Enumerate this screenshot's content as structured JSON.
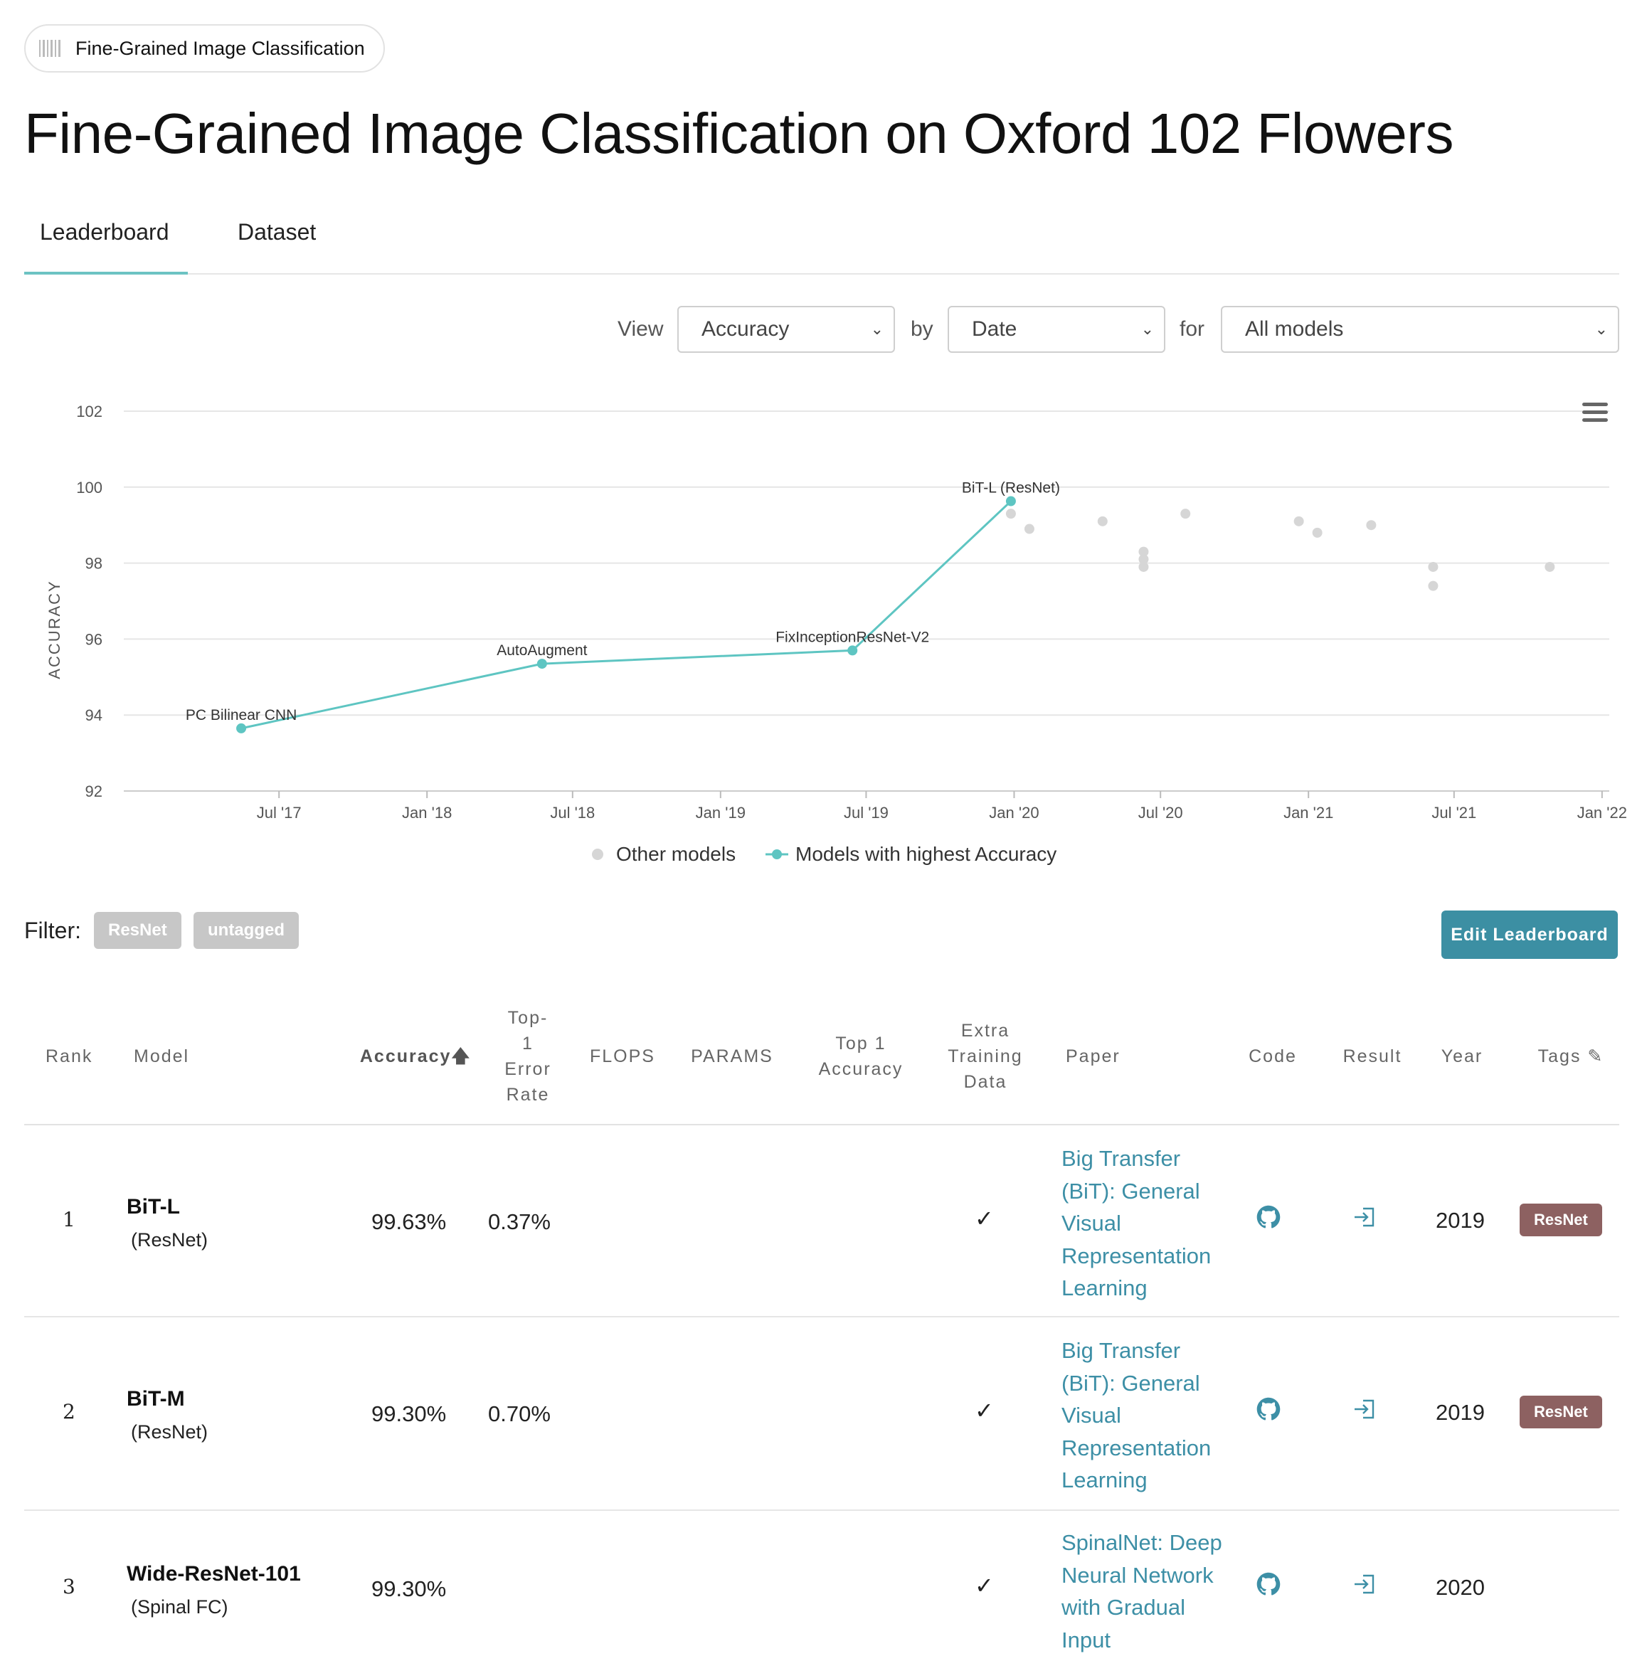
{
  "task_chip": {
    "label": "Fine-Grained Image Classification",
    "icon": "barcode-icon"
  },
  "page_title": "Fine-Grained Image Classification on Oxford 102 Flowers",
  "tabs": [
    {
      "label": "Leaderboard",
      "active": true
    },
    {
      "label": "Dataset",
      "active": false
    }
  ],
  "controls": {
    "view_label": "View",
    "view_value": "Accuracy",
    "by_label": "by",
    "by_value": "Date",
    "for_label": "for",
    "for_value": "All models"
  },
  "chart_data": {
    "type": "scatter",
    "ylabel": "ACCURACY",
    "ylim": [
      92,
      102
    ],
    "yticks": [
      92,
      94,
      96,
      98,
      100,
      102
    ],
    "xlim": [
      "2016-12-20",
      "2022-01-10"
    ],
    "xticks": [
      "2017-07-01",
      "2018-01-01",
      "2018-07-01",
      "2019-01-01",
      "2019-07-01",
      "2020-01-01",
      "2020-07-01",
      "2021-01-01",
      "2021-07-01",
      "2022-01-01"
    ],
    "xticklabels": [
      "Jul '17",
      "Jan '18",
      "Jul '18",
      "Jan '19",
      "Jul '19",
      "Jan '20",
      "Jul '20",
      "Jan '21",
      "Jul '21",
      "Jan '22"
    ],
    "grid": true,
    "legend_position": "bottom",
    "series": [
      {
        "name": "Other models",
        "color": "#d6d6d6",
        "points": [
          {
            "x": "2019-12-28",
            "y": 99.3
          },
          {
            "x": "2020-01-20",
            "y": 98.9
          },
          {
            "x": "2020-04-20",
            "y": 99.1
          },
          {
            "x": "2020-06-10",
            "y": 98.3
          },
          {
            "x": "2020-06-10",
            "y": 98.1
          },
          {
            "x": "2020-06-10",
            "y": 97.9
          },
          {
            "x": "2020-08-01",
            "y": 99.3
          },
          {
            "x": "2020-12-20",
            "y": 99.1
          },
          {
            "x": "2021-01-12",
            "y": 98.8
          },
          {
            "x": "2021-03-20",
            "y": 99.0
          },
          {
            "x": "2021-06-05",
            "y": 97.9
          },
          {
            "x": "2021-06-05",
            "y": 97.4
          },
          {
            "x": "2021-10-28",
            "y": 97.9
          }
        ]
      },
      {
        "name": "Models with highest Accuracy",
        "color": "#5ec5c2",
        "points": [
          {
            "x": "2017-05-15",
            "y": 93.65,
            "label": "PC Bilinear CNN"
          },
          {
            "x": "2018-05-24",
            "y": 95.35,
            "label": "AutoAugment"
          },
          {
            "x": "2019-06-14",
            "y": 95.7,
            "label": "FixInceptionResNet-V2"
          },
          {
            "x": "2019-12-28",
            "y": 99.63,
            "label": "BiT-L (ResNet)"
          }
        ]
      }
    ]
  },
  "filter": {
    "label": "Filter:",
    "tags": [
      "ResNet",
      "untagged"
    ]
  },
  "edit_button": "Edit Leaderboard",
  "table": {
    "headers": {
      "rank": "Rank",
      "model": "Model",
      "accuracy": "Accuracy",
      "top1_error": "Top-\n1\nError\nRate",
      "flops": "FLOPS",
      "params": "PARAMS",
      "top1_acc": "Top 1\nAccuracy",
      "extra": "Extra\nTraining\nData",
      "paper": "Paper",
      "code": "Code",
      "result": "Result",
      "year": "Year",
      "tags": "Tags"
    },
    "rows": [
      {
        "rank": "1",
        "model": "BiT-L",
        "model_sub": "(ResNet)",
        "accuracy": "99.63%",
        "top1_error": "0.37%",
        "extra": "✓",
        "paper": "Big Transfer (BiT): General Visual Representation Learning",
        "year": "2019",
        "tag": "ResNet"
      },
      {
        "rank": "2",
        "model": "BiT-M",
        "model_sub": "(ResNet)",
        "accuracy": "99.30%",
        "top1_error": "0.70%",
        "extra": "✓",
        "paper": "Big Transfer (BiT): General Visual Representation Learning",
        "year": "2019",
        "tag": "ResNet"
      },
      {
        "rank": "3",
        "model": "Wide-ResNet-101",
        "model_sub": "(Spinal FC)",
        "accuracy": "99.30%",
        "top1_error": "",
        "extra": "✓",
        "paper": "SpinalNet: Deep Neural Network with Gradual Input",
        "year": "2020",
        "tag": ""
      }
    ]
  }
}
